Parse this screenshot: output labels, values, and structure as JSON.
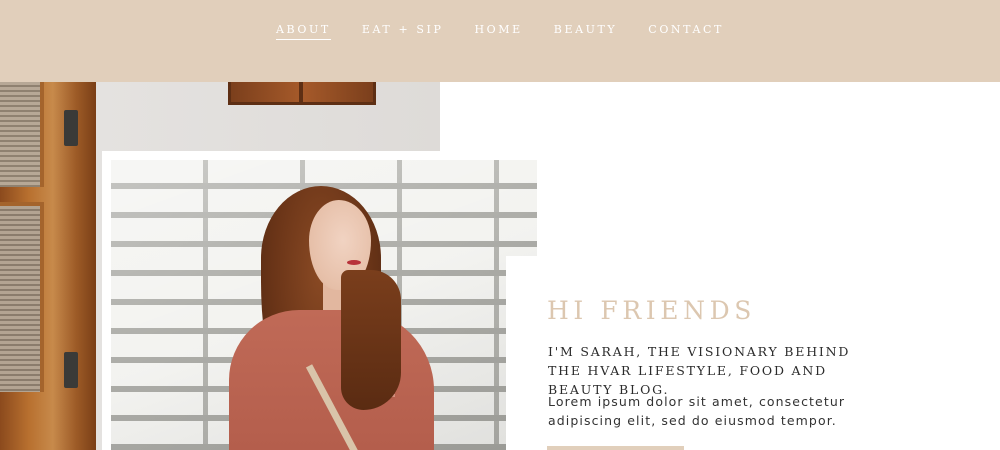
{
  "nav": {
    "items": [
      {
        "label": "ABOUT",
        "active": true
      },
      {
        "label": "EAT + SIP",
        "active": false
      },
      {
        "label": "HOME",
        "active": false
      },
      {
        "label": "BEAUTY",
        "active": false
      },
      {
        "label": "CONTACT",
        "active": false
      }
    ]
  },
  "hero": {
    "title": "HI FRIENDS",
    "intro": "I'M SARAH, THE VISIONARY BEHIND THE HVAR LIFESTYLE, FOOD AND BEAUTY BLOG.",
    "body": "Lorem ipsum dolor sit amet, consectetur adipiscing elit, sed do eiusmod tempor."
  },
  "colors": {
    "accent": "#e1cfbb",
    "title": "#dcc7b0",
    "text": "#2b2b2b",
    "background": "#ffffff"
  }
}
